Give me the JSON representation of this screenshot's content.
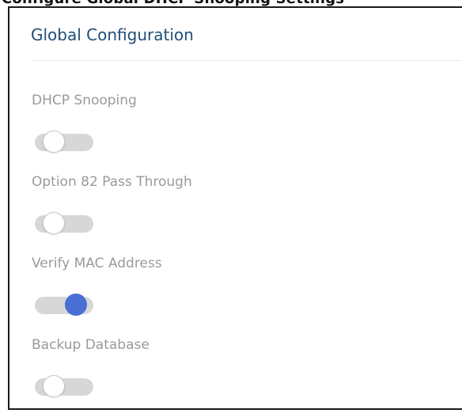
{
  "panel": {
    "title": "Global Configuration"
  },
  "settings": [
    {
      "label": "DHCP Snooping",
      "enabled": false
    },
    {
      "label": "Option 82 Pass Through",
      "enabled": false
    },
    {
      "label": "Verify MAC Address",
      "enabled": true
    },
    {
      "label": "Backup Database",
      "enabled": false
    }
  ],
  "colors": {
    "title": "#1f4e79",
    "label": "#9a9a9a",
    "toggle_track": "#d7d7d7",
    "toggle_on_knob": "#4a6fd4"
  }
}
